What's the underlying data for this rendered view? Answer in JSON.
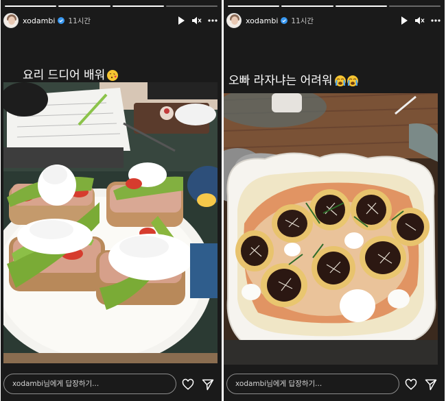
{
  "stories": [
    {
      "username": "xodambi",
      "time": "11시간",
      "caption": "요리 드디어 배워",
      "caption_emoji": [
        "face-blowing-kiss-emoji"
      ],
      "reply_placeholder": "xodambi님에게 답장하기...",
      "progress": [
        1,
        1,
        1,
        0
      ]
    },
    {
      "username": "xodambi",
      "time": "11시간",
      "caption": "오빠 라자냐는 어려워",
      "caption_emoji": [
        "loudly-crying-face-emoji",
        "loudly-crying-face-emoji"
      ],
      "reply_placeholder": "xodambi님에게 답장하기...",
      "progress": [
        1,
        1,
        1,
        0
      ]
    }
  ],
  "colors": {
    "story_bg": "#1a1a1a",
    "text": "#ffffff",
    "accent_verified": "#3897f0"
  }
}
